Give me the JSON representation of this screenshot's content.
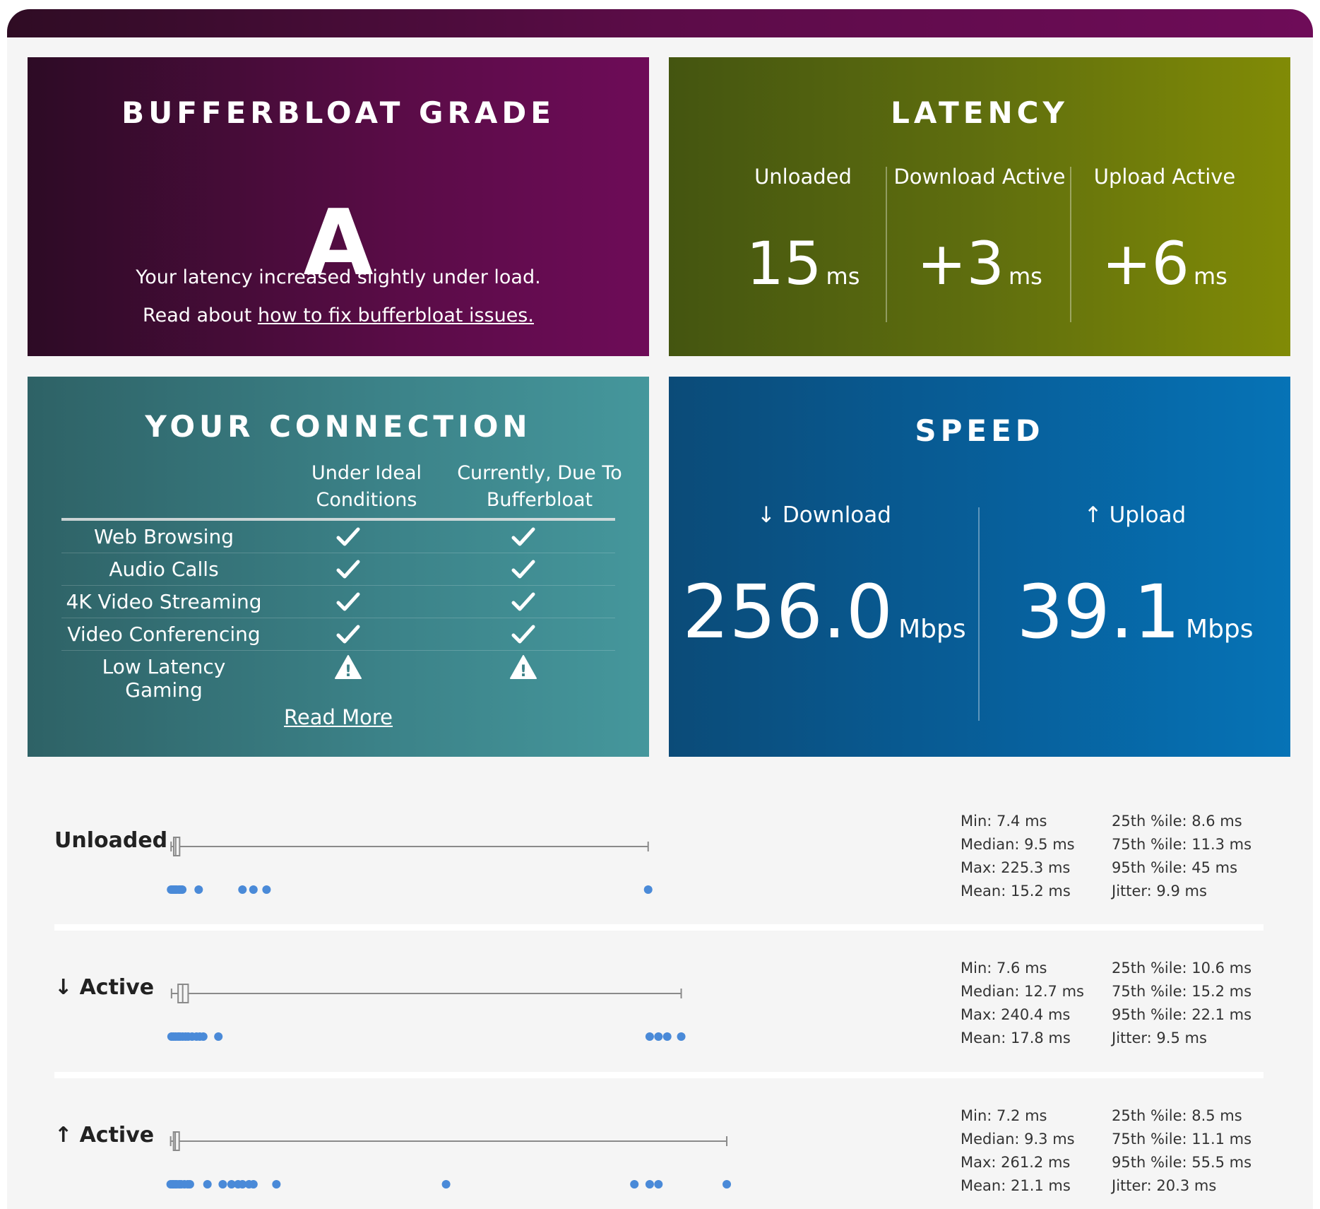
{
  "grade": {
    "title": "BUFFERBLOAT GRADE",
    "letter": "A",
    "description": "Your latency increased slightly under load.",
    "read_about_prefix": "Read about ",
    "fix_link": "how to fix bufferbloat issues."
  },
  "latency": {
    "title": "LATENCY",
    "columns": [
      {
        "label": "Unloaded",
        "value": "15",
        "unit": "ms"
      },
      {
        "label": "Download Active",
        "value": "+3",
        "unit": "ms"
      },
      {
        "label": "Upload Active",
        "value": "+6",
        "unit": "ms"
      }
    ]
  },
  "connection": {
    "title": "YOUR CONNECTION",
    "col_ideal_line1": "Under Ideal",
    "col_ideal_line2": "Conditions",
    "col_current_line1": "Currently, Due To",
    "col_current_line2": "Bufferbloat",
    "rows": [
      {
        "label": "Web Browsing",
        "ideal": "check",
        "current": "check"
      },
      {
        "label": "Audio Calls",
        "ideal": "check",
        "current": "check"
      },
      {
        "label": "4K Video Streaming",
        "ideal": "check",
        "current": "check"
      },
      {
        "label": "Video Conferencing",
        "ideal": "check",
        "current": "check"
      },
      {
        "label": "Low Latency Gaming",
        "ideal": "warning",
        "current": "warning"
      }
    ],
    "read_more": "Read More"
  },
  "speed": {
    "title": "SPEED",
    "download": {
      "label": "↓ Download",
      "value": "256.0",
      "unit": "Mbps"
    },
    "upload": {
      "label": "↑ Upload",
      "value": "39.1",
      "unit": "Mbps"
    }
  },
  "stats": [
    {
      "label": "Unloaded",
      "min": "Min: 7.4 ms",
      "median": "Median: 9.5 ms",
      "max": "Max: 225.3 ms",
      "mean": "Mean: 15.2 ms",
      "p25": "25th %ile: 8.6 ms",
      "p75": "75th %ile: 11.3 ms",
      "p95": "95th %ile: 45 ms",
      "jitter": "Jitter: 9.9 ms",
      "box": {
        "min": 7.4,
        "q1": 8.6,
        "median": 9.5,
        "q3": 11.3,
        "max": 225.3
      },
      "points": [
        7.4,
        8,
        8.6,
        9,
        9.5,
        10,
        11,
        11.3,
        12,
        12.5,
        20,
        40,
        45,
        51,
        225.3
      ]
    },
    {
      "label": "↓ Active",
      "min": "Min: 7.6 ms",
      "median": "Median: 12.7 ms",
      "max": "Max: 240.4 ms",
      "mean": "Mean: 17.8 ms",
      "p25": "25th %ile: 10.6 ms",
      "p75": "75th %ile: 15.2 ms",
      "p95": "95th %ile: 22.1 ms",
      "jitter": "Jitter: 9.5 ms",
      "box": {
        "min": 7.6,
        "q1": 10.6,
        "median": 12.7,
        "q3": 15.2,
        "max": 240.4
      },
      "points": [
        7.6,
        8.5,
        9.5,
        10.6,
        11.5,
        12.7,
        14,
        15.2,
        17,
        19,
        20.5,
        22.1,
        29,
        226,
        230,
        234,
        240.4
      ]
    },
    {
      "label": "↑ Active",
      "min": "Min: 7.2 ms",
      "median": "Median: 9.3 ms",
      "max": "Max: 261.2 ms",
      "mean": "Mean: 21.1 ms",
      "p25": "25th %ile: 8.5 ms",
      "p75": "75th %ile: 11.1 ms",
      "p95": "95th %ile: 55.5 ms",
      "jitter": "Jitter: 20.3 ms",
      "box": {
        "min": 7.2,
        "q1": 8.5,
        "median": 9.3,
        "q3": 11.1,
        "max": 261.2
      },
      "points": [
        7.2,
        8,
        8.5,
        9.3,
        10,
        11.1,
        12,
        13.5,
        15,
        16,
        24,
        31,
        35,
        38,
        40,
        43,
        45,
        55.5,
        133,
        219,
        226,
        230,
        261.2
      ]
    }
  ],
  "colors": {
    "dot": "#4a8ad8",
    "box_line": "#8a8a8a"
  }
}
